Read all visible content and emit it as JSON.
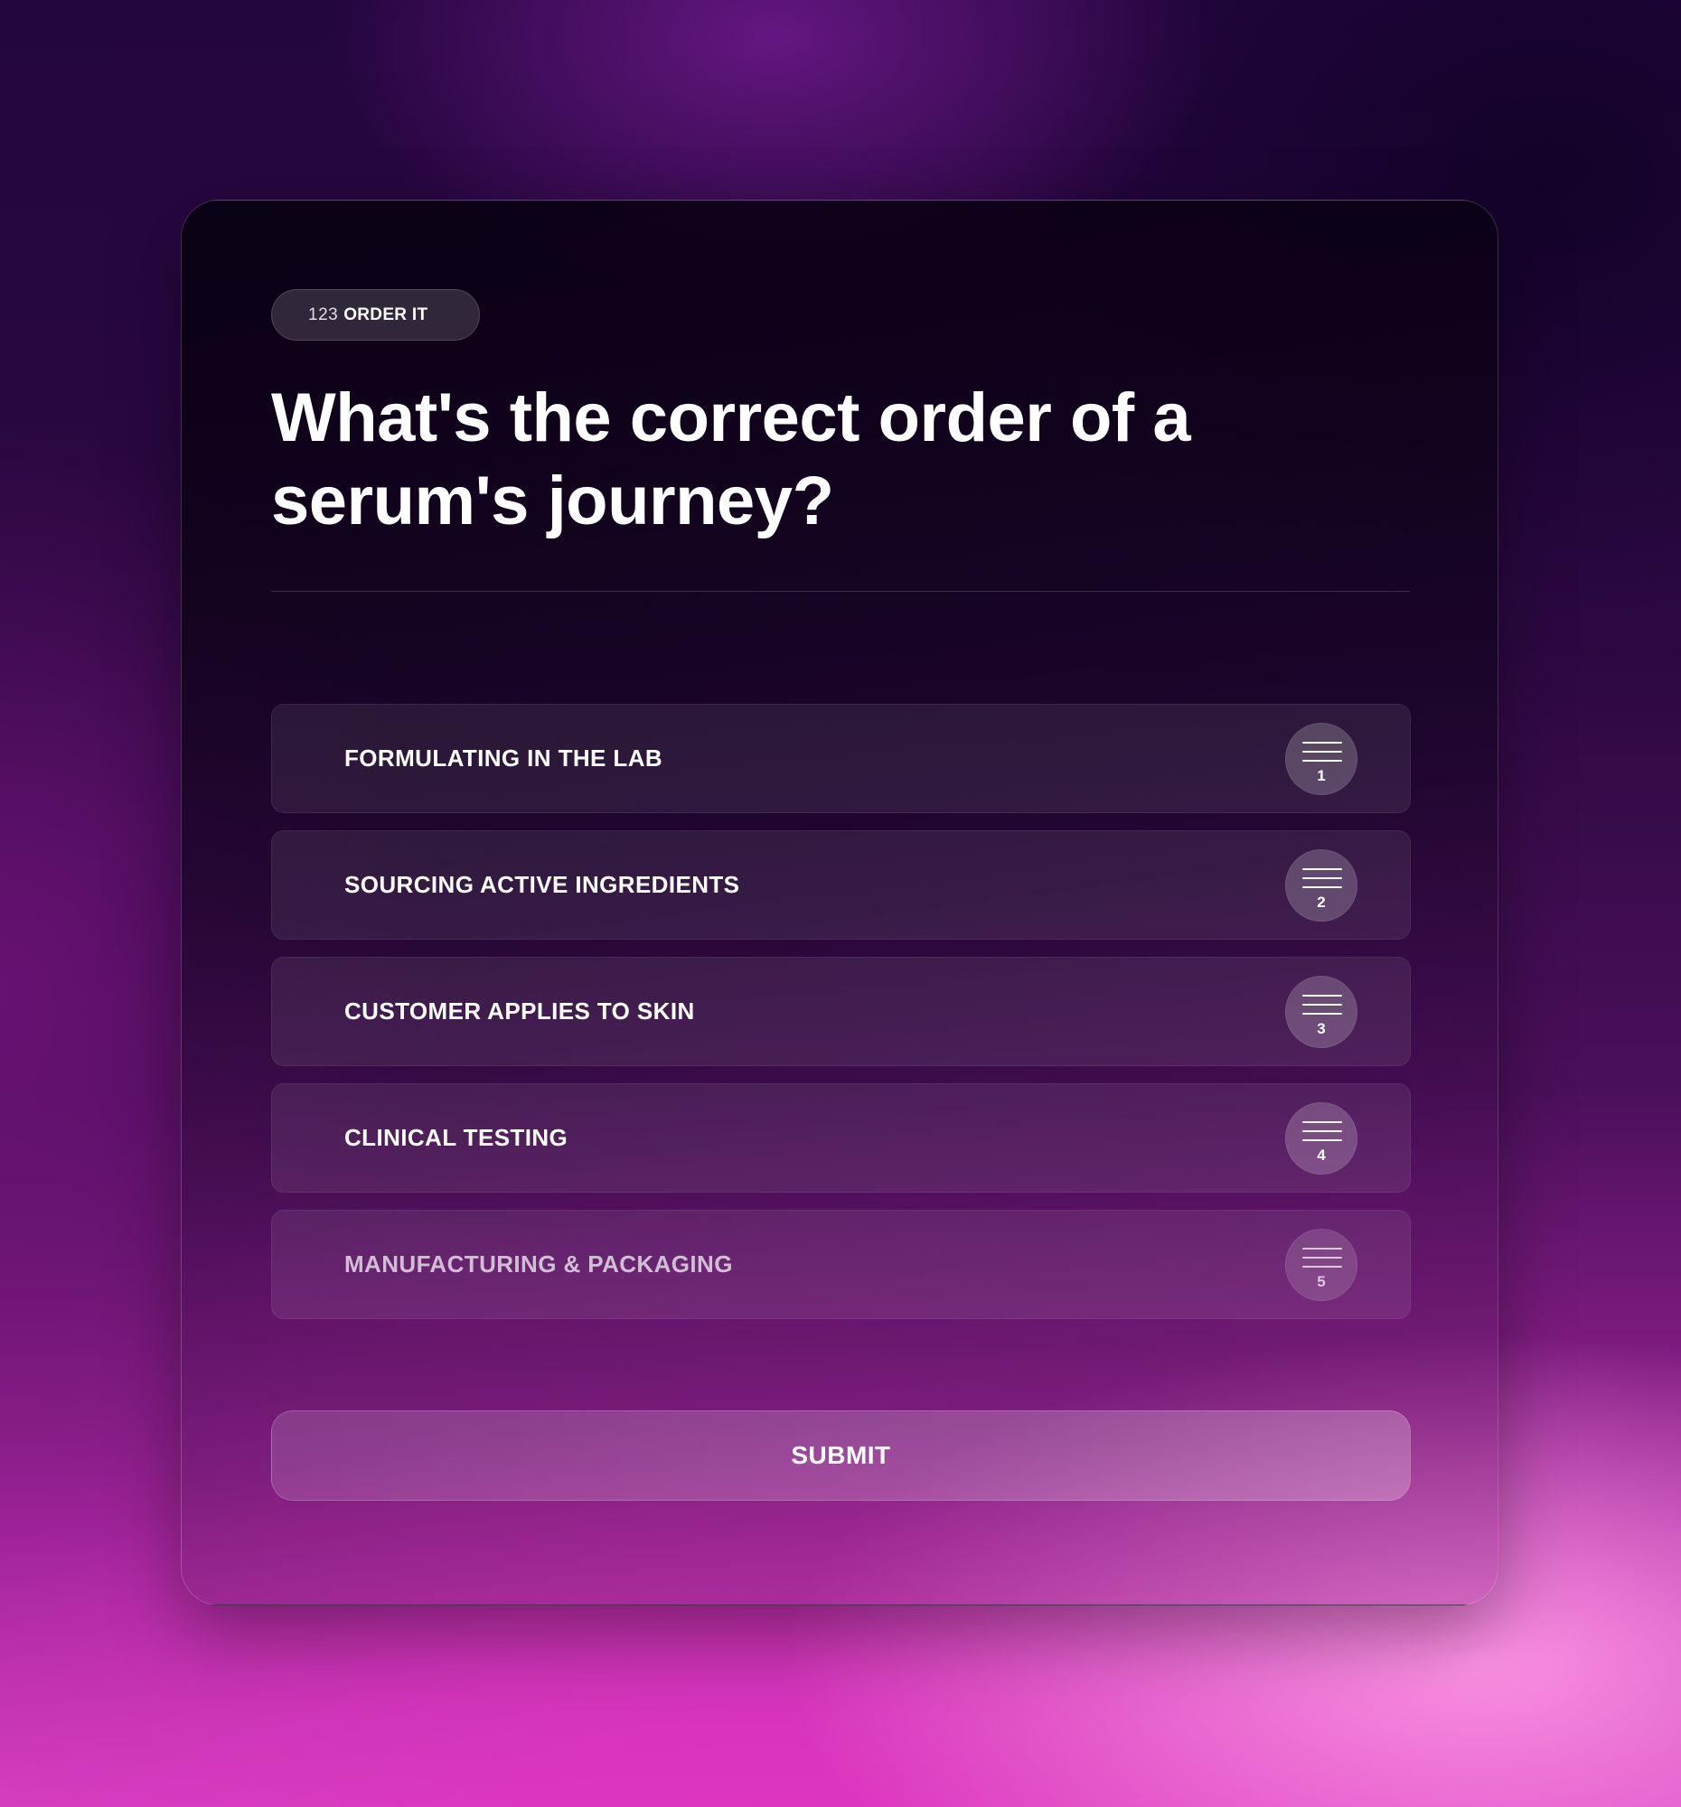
{
  "badge": {
    "icon": "123",
    "label": "ORDER IT"
  },
  "question": "What's the correct order of a serum's journey?",
  "options": [
    {
      "label": "FORMULATING IN THE LAB",
      "position": "1"
    },
    {
      "label": "SOURCING ACTIVE INGREDIENTS",
      "position": "2"
    },
    {
      "label": "CUSTOMER APPLIES TO SKIN",
      "position": "3"
    },
    {
      "label": "CLINICAL TESTING",
      "position": "4"
    },
    {
      "label": "MANUFACTURING & PACKAGING",
      "position": "5"
    }
  ],
  "submit_label": "SUBMIT",
  "colors": {
    "background_top": "#24063f",
    "background_bottom": "#d33fbf",
    "card": "#0e0318",
    "text": "#ffffff"
  }
}
